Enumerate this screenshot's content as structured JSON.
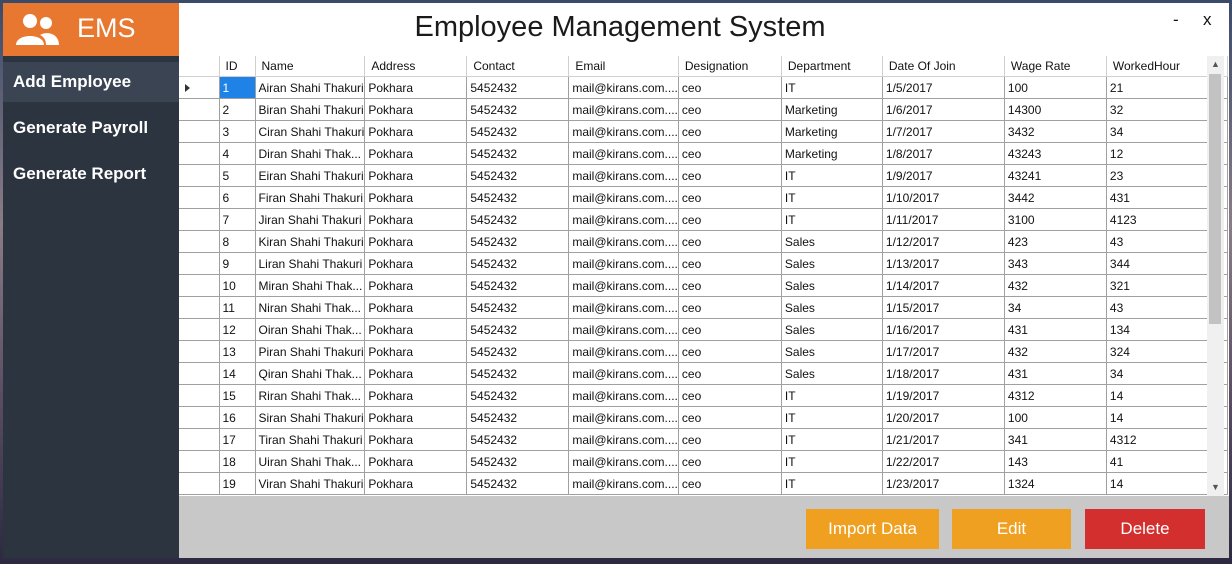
{
  "app": {
    "logo_text": "EMS",
    "title": "Employee Management System",
    "minimize_label": "-",
    "close_label": "x"
  },
  "sidebar": {
    "items": [
      {
        "label": "Add Employee"
      },
      {
        "label": "Generate Payroll"
      },
      {
        "label": "Generate Report"
      }
    ]
  },
  "table": {
    "columns": [
      "ID",
      "Name",
      "Address",
      "Contact",
      "Email",
      "Designation",
      "Department",
      "Date Of Join",
      "Wage Rate",
      "WorkedHour"
    ],
    "rows": [
      [
        "1",
        "Airan Shahi Thakuri",
        "Pokhara",
        "5452432",
        "mail@kirans.com....",
        "ceo",
        "IT",
        "1/5/2017",
        "100",
        "21"
      ],
      [
        "2",
        "Biran Shahi Thakuri",
        "Pokhara",
        "5452432",
        "mail@kirans.com....",
        "ceo",
        "Marketing",
        "1/6/2017",
        "14300",
        "32"
      ],
      [
        "3",
        "Ciran Shahi Thakuri",
        "Pokhara",
        "5452432",
        "mail@kirans.com....",
        "ceo",
        "Marketing",
        "1/7/2017",
        "3432",
        "34"
      ],
      [
        "4",
        "Diran Shahi Thak...",
        "Pokhara",
        "5452432",
        "mail@kirans.com....",
        "ceo",
        "Marketing",
        "1/8/2017",
        "43243",
        "12"
      ],
      [
        "5",
        "Eiran Shahi Thakuri",
        "Pokhara",
        "5452432",
        "mail@kirans.com....",
        "ceo",
        "IT",
        "1/9/2017",
        "43241",
        "23"
      ],
      [
        "6",
        "Firan Shahi Thakuri",
        "Pokhara",
        "5452432",
        "mail@kirans.com....",
        "ceo",
        "IT",
        "1/10/2017",
        "3442",
        "431"
      ],
      [
        "7",
        "Jiran Shahi Thakuri",
        "Pokhara",
        "5452432",
        "mail@kirans.com....",
        "ceo",
        "IT",
        "1/11/2017",
        "3100",
        "4123"
      ],
      [
        "8",
        "Kiran Shahi Thakuri",
        "Pokhara",
        "5452432",
        "mail@kirans.com....",
        "ceo",
        "Sales",
        "1/12/2017",
        "423",
        "43"
      ],
      [
        "9",
        "Liran Shahi Thakuri",
        "Pokhara",
        "5452432",
        "mail@kirans.com....",
        "ceo",
        "Sales",
        "1/13/2017",
        "343",
        "344"
      ],
      [
        "10",
        "Miran Shahi Thak...",
        "Pokhara",
        "5452432",
        "mail@kirans.com....",
        "ceo",
        "Sales",
        "1/14/2017",
        "432",
        "321"
      ],
      [
        "11",
        "Niran Shahi Thak...",
        "Pokhara",
        "5452432",
        "mail@kirans.com....",
        "ceo",
        "Sales",
        "1/15/2017",
        "34",
        "43"
      ],
      [
        "12",
        "Oiran Shahi Thak...",
        "Pokhara",
        "5452432",
        "mail@kirans.com....",
        "ceo",
        "Sales",
        "1/16/2017",
        "431",
        "134"
      ],
      [
        "13",
        "Piran Shahi Thakuri",
        "Pokhara",
        "5452432",
        "mail@kirans.com....",
        "ceo",
        "Sales",
        "1/17/2017",
        "432",
        "324"
      ],
      [
        "14",
        "Qiran Shahi Thak...",
        "Pokhara",
        "5452432",
        "mail@kirans.com....",
        "ceo",
        "Sales",
        "1/18/2017",
        "431",
        "34"
      ],
      [
        "15",
        "Riran Shahi Thak...",
        "Pokhara",
        "5452432",
        "mail@kirans.com....",
        "ceo",
        "IT",
        "1/19/2017",
        "4312",
        "14"
      ],
      [
        "16",
        "Siran Shahi Thakuri",
        "Pokhara",
        "5452432",
        "mail@kirans.com....",
        "ceo",
        "IT",
        "1/20/2017",
        "100",
        "14"
      ],
      [
        "17",
        "Tiran Shahi Thakuri",
        "Pokhara",
        "5452432",
        "mail@kirans.com....",
        "ceo",
        "IT",
        "1/21/2017",
        "341",
        "4312"
      ],
      [
        "18",
        "Uiran Shahi Thak...",
        "Pokhara",
        "5452432",
        "mail@kirans.com....",
        "ceo",
        "IT",
        "1/22/2017",
        "143",
        "41"
      ],
      [
        "19",
        "Viran Shahi Thakuri",
        "Pokhara",
        "5452432",
        "mail@kirans.com....",
        "ceo",
        "IT",
        "1/23/2017",
        "1324",
        "14"
      ]
    ]
  },
  "actions": {
    "import_label": "Import Data",
    "edit_label": "Edit",
    "delete_label": "Delete"
  },
  "colors": {
    "accent_orange": "#e8782f",
    "button_orange": "#f0a020",
    "delete_red": "#d32f2f",
    "sidebar_bg": "#2c3440",
    "selection_blue": "#1e82e6"
  },
  "icons": {
    "logo": "users-icon",
    "current_row": "row-pointer-icon"
  }
}
